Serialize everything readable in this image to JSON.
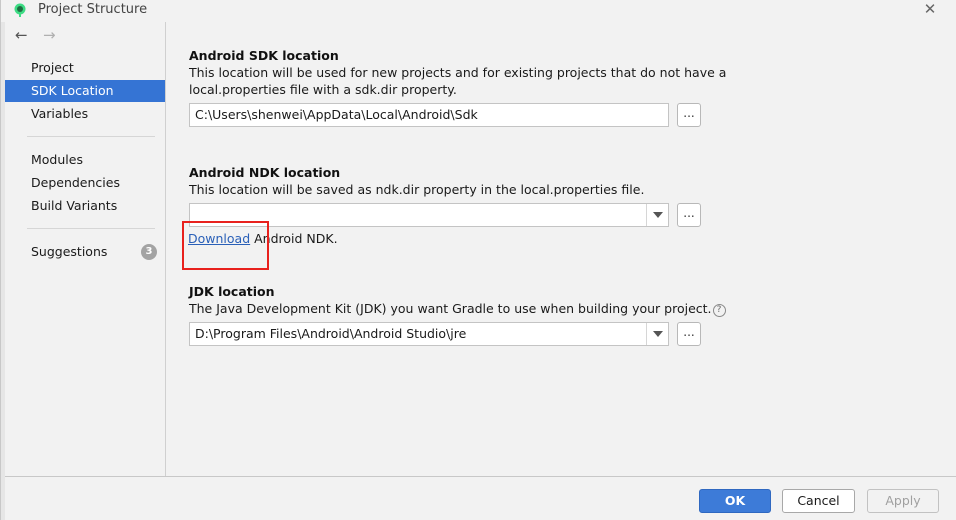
{
  "window": {
    "title": "Project Structure",
    "close_glyph": "✕"
  },
  "sidebar": {
    "back_glyph": "←",
    "forward_glyph": "→",
    "items": [
      {
        "label": "Project"
      },
      {
        "label": "SDK Location"
      },
      {
        "label": "Variables"
      },
      {
        "label": "Modules"
      },
      {
        "label": "Dependencies"
      },
      {
        "label": "Build Variants"
      },
      {
        "label": "Suggestions"
      }
    ],
    "selected": "SDK Location",
    "suggestions_count": "3"
  },
  "sdk": {
    "title": "Android SDK location",
    "description_line1": "This location will be used for new projects and for existing projects that do not have a",
    "description_line2": "local.properties file with a sdk.dir property.",
    "path": "C:\\Users\\shenwei\\AppData\\Local\\Android\\Sdk",
    "browse_label": "..."
  },
  "ndk": {
    "title": "Android NDK location",
    "description": "This location will be saved as ndk.dir property in the local.properties file.",
    "path": "",
    "browse_label": "...",
    "download_link": "Download",
    "download_suffix": " Android NDK."
  },
  "jdk": {
    "title": "JDK location",
    "description": "The Java Development Kit (JDK) you want Gradle to use when building your project.",
    "help_glyph": "?",
    "path": "D:\\Program Files\\Android\\Android Studio\\jre",
    "browse_label": "..."
  },
  "footer": {
    "ok_label": "OK",
    "cancel_label": "Cancel",
    "apply_label": "Apply"
  },
  "colors": {
    "selection": "#3574d4",
    "ok_button": "#3d7bd8",
    "highlight_box": "#e8211d",
    "link": "#2a60b8"
  },
  "icons": [
    "android-studio-icon",
    "close-icon",
    "back-arrow-icon",
    "forward-arrow-icon",
    "dropdown-arrow-icon",
    "help-icon"
  ]
}
